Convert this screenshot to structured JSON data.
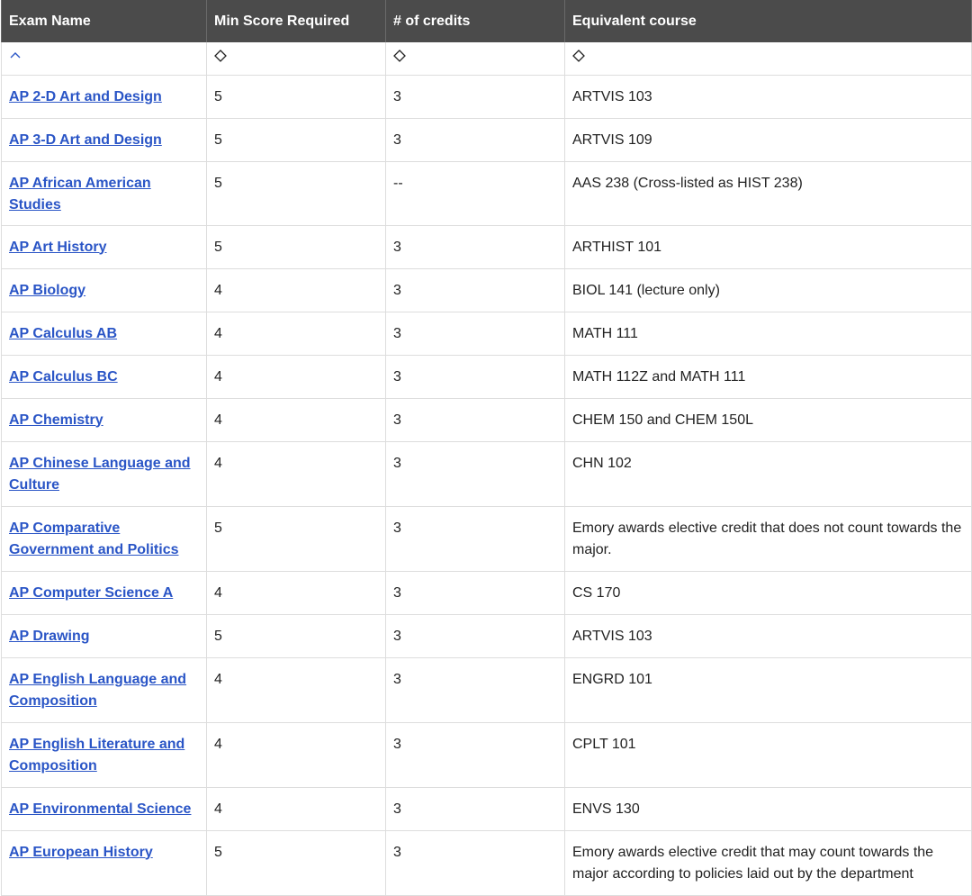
{
  "table": {
    "headers": [
      "Exam Name",
      "Min Score Required",
      "# of credits",
      "Equivalent course"
    ],
    "sort_icons": [
      "chevron-up-icon",
      "sort-both-icon",
      "sort-both-icon",
      "sort-both-icon"
    ],
    "accent_color": "#2a55c6",
    "header_bg": "#4b4b4b",
    "rows": [
      {
        "exam": "AP 2-D Art and Design",
        "score": "5",
        "credits": "3",
        "course": "ARTVIS 103"
      },
      {
        "exam": "AP 3-D Art and Design",
        "score": "5",
        "credits": "3",
        "course": "ARTVIS 109"
      },
      {
        "exam": "AP African American Studies",
        "score": "5",
        "credits": "--",
        "course": "AAS 238 (Cross-listed as HIST 238)"
      },
      {
        "exam": "AP Art History",
        "score": "5",
        "credits": "3",
        "course": "ARTHIST 101"
      },
      {
        "exam": "AP Biology",
        "score": "4",
        "credits": "3",
        "course": "BIOL 141 (lecture only)"
      },
      {
        "exam": "AP Calculus AB",
        "score": "4",
        "credits": "3",
        "course": "MATH 111"
      },
      {
        "exam": "AP Calculus BC",
        "score": "4",
        "credits": "3",
        "course": "MATH 112Z and MATH 111"
      },
      {
        "exam": "AP Chemistry",
        "score": "4",
        "credits": "3",
        "course": "CHEM 150 and CHEM 150L"
      },
      {
        "exam": "AP Chinese Language and Culture",
        "score": "4",
        "credits": "3",
        "course": "CHN 102"
      },
      {
        "exam": "AP Comparative Government and Politics",
        "score": "5",
        "credits": "3",
        "course": "Emory awards elective credit that does not count towards the major."
      },
      {
        "exam": "AP Computer Science A",
        "score": "4",
        "credits": "3",
        "course": "CS 170"
      },
      {
        "exam": "AP Drawing",
        "score": "5",
        "credits": "3",
        "course": "ARTVIS 103"
      },
      {
        "exam": "AP English Language and Composition",
        "score": "4",
        "credits": "3",
        "course": "ENGRD 101"
      },
      {
        "exam": "AP English Literature and Composition",
        "score": "4",
        "credits": "3",
        "course": "CPLT 101"
      },
      {
        "exam": "AP Environmental Science",
        "score": "4",
        "credits": "3",
        "course": "ENVS 130"
      },
      {
        "exam": "AP European History",
        "score": "5",
        "credits": "3",
        "course": "Emory awards elective credit that may count towards the major according to policies laid out by the department"
      }
    ]
  }
}
